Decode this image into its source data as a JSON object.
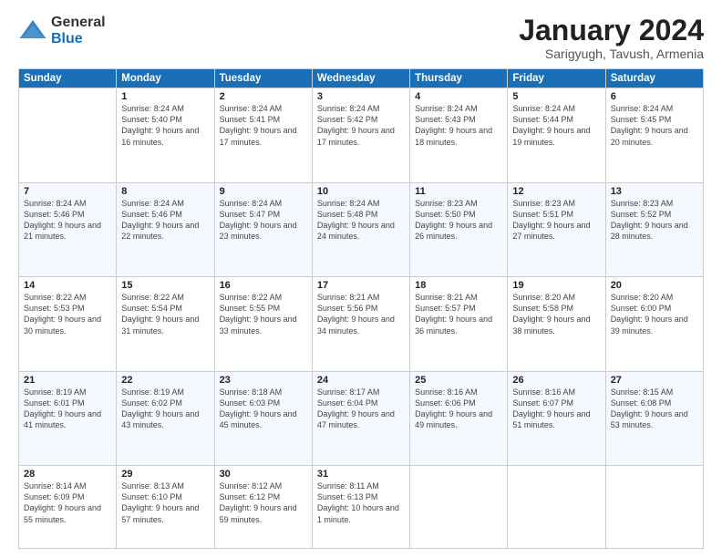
{
  "logo": {
    "general": "General",
    "blue": "Blue"
  },
  "header": {
    "month": "January 2024",
    "location": "Sarigyugh, Tavush, Armenia"
  },
  "weekdays": [
    "Sunday",
    "Monday",
    "Tuesday",
    "Wednesday",
    "Thursday",
    "Friday",
    "Saturday"
  ],
  "weeks": [
    [
      {
        "day": "",
        "sunrise": "",
        "sunset": "",
        "daylight": ""
      },
      {
        "day": "1",
        "sunrise": "Sunrise: 8:24 AM",
        "sunset": "Sunset: 5:40 PM",
        "daylight": "Daylight: 9 hours and 16 minutes."
      },
      {
        "day": "2",
        "sunrise": "Sunrise: 8:24 AM",
        "sunset": "Sunset: 5:41 PM",
        "daylight": "Daylight: 9 hours and 17 minutes."
      },
      {
        "day": "3",
        "sunrise": "Sunrise: 8:24 AM",
        "sunset": "Sunset: 5:42 PM",
        "daylight": "Daylight: 9 hours and 17 minutes."
      },
      {
        "day": "4",
        "sunrise": "Sunrise: 8:24 AM",
        "sunset": "Sunset: 5:43 PM",
        "daylight": "Daylight: 9 hours and 18 minutes."
      },
      {
        "day": "5",
        "sunrise": "Sunrise: 8:24 AM",
        "sunset": "Sunset: 5:44 PM",
        "daylight": "Daylight: 9 hours and 19 minutes."
      },
      {
        "day": "6",
        "sunrise": "Sunrise: 8:24 AM",
        "sunset": "Sunset: 5:45 PM",
        "daylight": "Daylight: 9 hours and 20 minutes."
      }
    ],
    [
      {
        "day": "7",
        "sunrise": "Sunrise: 8:24 AM",
        "sunset": "Sunset: 5:46 PM",
        "daylight": "Daylight: 9 hours and 21 minutes."
      },
      {
        "day": "8",
        "sunrise": "Sunrise: 8:24 AM",
        "sunset": "Sunset: 5:46 PM",
        "daylight": "Daylight: 9 hours and 22 minutes."
      },
      {
        "day": "9",
        "sunrise": "Sunrise: 8:24 AM",
        "sunset": "Sunset: 5:47 PM",
        "daylight": "Daylight: 9 hours and 23 minutes."
      },
      {
        "day": "10",
        "sunrise": "Sunrise: 8:24 AM",
        "sunset": "Sunset: 5:48 PM",
        "daylight": "Daylight: 9 hours and 24 minutes."
      },
      {
        "day": "11",
        "sunrise": "Sunrise: 8:23 AM",
        "sunset": "Sunset: 5:50 PM",
        "daylight": "Daylight: 9 hours and 26 minutes."
      },
      {
        "day": "12",
        "sunrise": "Sunrise: 8:23 AM",
        "sunset": "Sunset: 5:51 PM",
        "daylight": "Daylight: 9 hours and 27 minutes."
      },
      {
        "day": "13",
        "sunrise": "Sunrise: 8:23 AM",
        "sunset": "Sunset: 5:52 PM",
        "daylight": "Daylight: 9 hours and 28 minutes."
      }
    ],
    [
      {
        "day": "14",
        "sunrise": "Sunrise: 8:22 AM",
        "sunset": "Sunset: 5:53 PM",
        "daylight": "Daylight: 9 hours and 30 minutes."
      },
      {
        "day": "15",
        "sunrise": "Sunrise: 8:22 AM",
        "sunset": "Sunset: 5:54 PM",
        "daylight": "Daylight: 9 hours and 31 minutes."
      },
      {
        "day": "16",
        "sunrise": "Sunrise: 8:22 AM",
        "sunset": "Sunset: 5:55 PM",
        "daylight": "Daylight: 9 hours and 33 minutes."
      },
      {
        "day": "17",
        "sunrise": "Sunrise: 8:21 AM",
        "sunset": "Sunset: 5:56 PM",
        "daylight": "Daylight: 9 hours and 34 minutes."
      },
      {
        "day": "18",
        "sunrise": "Sunrise: 8:21 AM",
        "sunset": "Sunset: 5:57 PM",
        "daylight": "Daylight: 9 hours and 36 minutes."
      },
      {
        "day": "19",
        "sunrise": "Sunrise: 8:20 AM",
        "sunset": "Sunset: 5:58 PM",
        "daylight": "Daylight: 9 hours and 38 minutes."
      },
      {
        "day": "20",
        "sunrise": "Sunrise: 8:20 AM",
        "sunset": "Sunset: 6:00 PM",
        "daylight": "Daylight: 9 hours and 39 minutes."
      }
    ],
    [
      {
        "day": "21",
        "sunrise": "Sunrise: 8:19 AM",
        "sunset": "Sunset: 6:01 PM",
        "daylight": "Daylight: 9 hours and 41 minutes."
      },
      {
        "day": "22",
        "sunrise": "Sunrise: 8:19 AM",
        "sunset": "Sunset: 6:02 PM",
        "daylight": "Daylight: 9 hours and 43 minutes."
      },
      {
        "day": "23",
        "sunrise": "Sunrise: 8:18 AM",
        "sunset": "Sunset: 6:03 PM",
        "daylight": "Daylight: 9 hours and 45 minutes."
      },
      {
        "day": "24",
        "sunrise": "Sunrise: 8:17 AM",
        "sunset": "Sunset: 6:04 PM",
        "daylight": "Daylight: 9 hours and 47 minutes."
      },
      {
        "day": "25",
        "sunrise": "Sunrise: 8:16 AM",
        "sunset": "Sunset: 6:06 PM",
        "daylight": "Daylight: 9 hours and 49 minutes."
      },
      {
        "day": "26",
        "sunrise": "Sunrise: 8:16 AM",
        "sunset": "Sunset: 6:07 PM",
        "daylight": "Daylight: 9 hours and 51 minutes."
      },
      {
        "day": "27",
        "sunrise": "Sunrise: 8:15 AM",
        "sunset": "Sunset: 6:08 PM",
        "daylight": "Daylight: 9 hours and 53 minutes."
      }
    ],
    [
      {
        "day": "28",
        "sunrise": "Sunrise: 8:14 AM",
        "sunset": "Sunset: 6:09 PM",
        "daylight": "Daylight: 9 hours and 55 minutes."
      },
      {
        "day": "29",
        "sunrise": "Sunrise: 8:13 AM",
        "sunset": "Sunset: 6:10 PM",
        "daylight": "Daylight: 9 hours and 57 minutes."
      },
      {
        "day": "30",
        "sunrise": "Sunrise: 8:12 AM",
        "sunset": "Sunset: 6:12 PM",
        "daylight": "Daylight: 9 hours and 59 minutes."
      },
      {
        "day": "31",
        "sunrise": "Sunrise: 8:11 AM",
        "sunset": "Sunset: 6:13 PM",
        "daylight": "Daylight: 10 hours and 1 minute."
      },
      {
        "day": "",
        "sunrise": "",
        "sunset": "",
        "daylight": ""
      },
      {
        "day": "",
        "sunrise": "",
        "sunset": "",
        "daylight": ""
      },
      {
        "day": "",
        "sunrise": "",
        "sunset": "",
        "daylight": ""
      }
    ]
  ]
}
